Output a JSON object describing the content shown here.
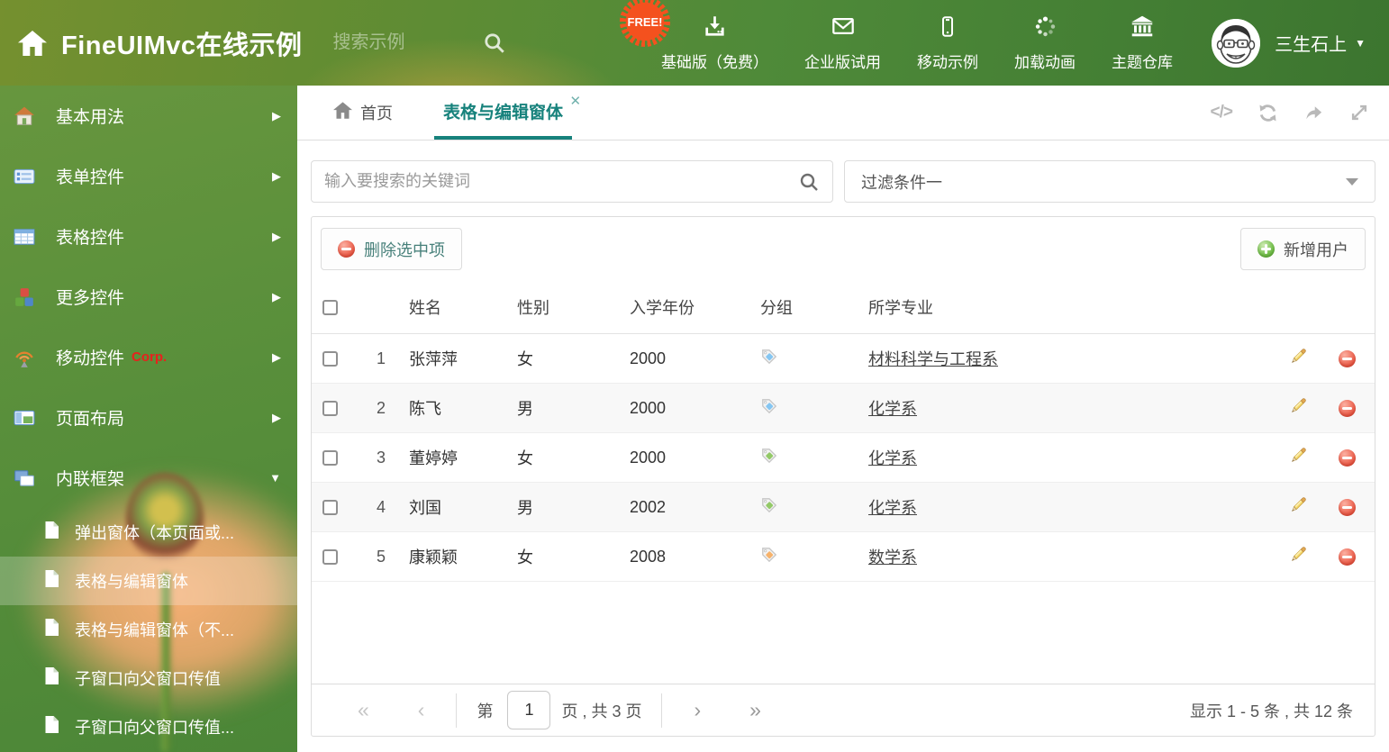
{
  "header": {
    "title": "FineUIMvc在线示例",
    "search_placeholder": "搜索示例",
    "free_badge": "FREE!",
    "nav": [
      {
        "icon": "download-icon",
        "label": "基础版（免费）"
      },
      {
        "icon": "envelope-icon",
        "label": "企业版试用"
      },
      {
        "icon": "mobile-icon",
        "label": "移动示例"
      },
      {
        "icon": "spinner-icon",
        "label": "加载动画"
      },
      {
        "icon": "bank-icon",
        "label": "主题仓库"
      }
    ],
    "username": "三生石上"
  },
  "sidebar": {
    "items": [
      {
        "icon": "home-colored-icon",
        "label": "基本用法"
      },
      {
        "icon": "form-icon",
        "label": "表单控件"
      },
      {
        "icon": "table-icon",
        "label": "表格控件"
      },
      {
        "icon": "cubes-icon",
        "label": "更多控件"
      },
      {
        "icon": "wireless-icon",
        "label": "移动控件",
        "badge": "Corp."
      },
      {
        "icon": "layout-icon",
        "label": "页面布局"
      },
      {
        "icon": "frames-icon",
        "label": "内联框架",
        "expanded": true
      }
    ],
    "subitems": [
      {
        "label": "弹出窗体（本页面或..."
      },
      {
        "label": "表格与编辑窗体",
        "selected": true
      },
      {
        "label": "表格与编辑窗体（不..."
      },
      {
        "label": "子窗口向父窗口传值"
      },
      {
        "label": "子窗口向父窗口传值..."
      }
    ]
  },
  "tabs": [
    {
      "label": "首页"
    },
    {
      "label": "表格与编辑窗体",
      "active": true,
      "close": "✕"
    }
  ],
  "filter": {
    "search_placeholder": "输入要搜索的关键词",
    "dropdown_value": "过滤条件一"
  },
  "toolbar": {
    "delete_label": "删除选中项",
    "add_label": "新增用户"
  },
  "table": {
    "columns": [
      "姓名",
      "性别",
      "入学年份",
      "分组",
      "所学专业"
    ],
    "rows": [
      {
        "index": "1",
        "name": "张萍萍",
        "gender": "女",
        "year": "2000",
        "tag_color": "blue",
        "major": "材料科学与工程系"
      },
      {
        "index": "2",
        "name": "陈飞",
        "gender": "男",
        "year": "2000",
        "tag_color": "blue",
        "major": "化学系"
      },
      {
        "index": "3",
        "name": "董婷婷",
        "gender": "女",
        "year": "2000",
        "tag_color": "green",
        "major": "化学系"
      },
      {
        "index": "4",
        "name": "刘国",
        "gender": "男",
        "year": "2002",
        "tag_color": "green",
        "major": "化学系"
      },
      {
        "index": "5",
        "name": "康颖颖",
        "gender": "女",
        "year": "2008",
        "tag_color": "orange",
        "major": "数学系"
      }
    ]
  },
  "pager": {
    "prefix": "第",
    "page": "1",
    "suffix": "页 , 共 3 页",
    "summary": "显示 1 - 5 条 , 共 12 条"
  },
  "colors": {
    "accent": "#17827c",
    "free_badge": "#f4511e",
    "tag_blue": "#85c6f2",
    "tag_green": "#93c968",
    "tag_orange": "#f6b26b"
  }
}
